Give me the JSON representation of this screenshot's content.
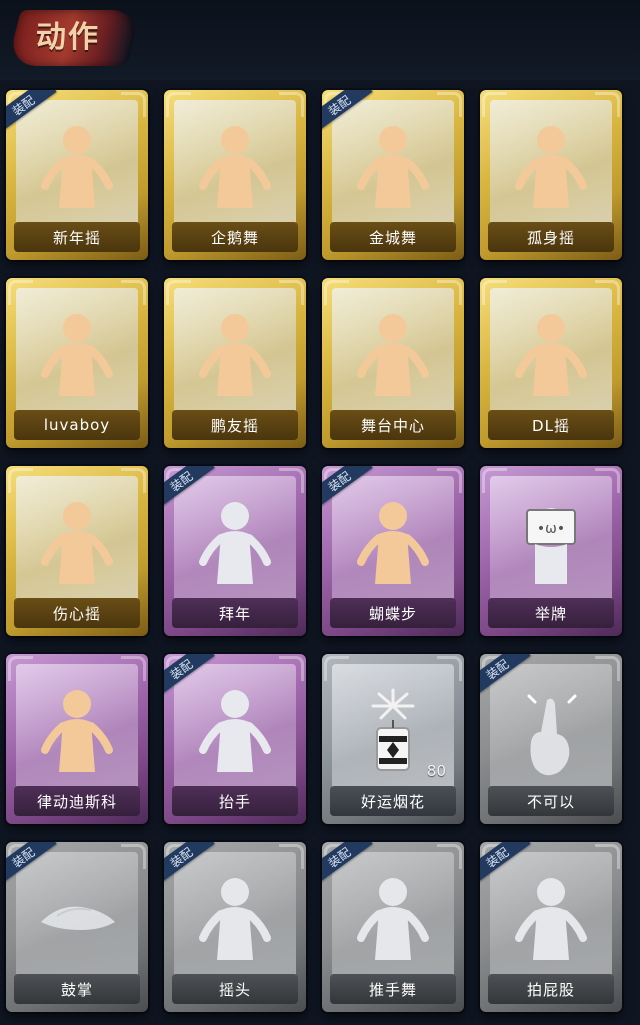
{
  "header": {
    "title": "动作"
  },
  "badge_label": "装配",
  "items": [
    {
      "label": "新年摇",
      "tier": "gold",
      "equipped": true,
      "icon": "dancer-clap-icon"
    },
    {
      "label": "企鹅舞",
      "tier": "gold",
      "equipped": false,
      "icon": "dancer-penguin-icon"
    },
    {
      "label": "金城舞",
      "tier": "gold",
      "equipped": true,
      "icon": "dancer-wave-icon"
    },
    {
      "label": "孤身摇",
      "tier": "gold",
      "equipped": false,
      "icon": "dancer-sway-icon"
    },
    {
      "label": "luvaboy",
      "tier": "gold",
      "equipped": false,
      "icon": "dancer-cross-icon"
    },
    {
      "label": "鹏友摇",
      "tier": "gold",
      "equipped": false,
      "icon": "dancer-shake-icon"
    },
    {
      "label": "舞台中心",
      "tier": "gold",
      "equipped": false,
      "icon": "dancer-center-icon"
    },
    {
      "label": "DL摇",
      "tier": "gold",
      "equipped": false,
      "icon": "dancer-point-icon"
    },
    {
      "label": "伤心摇",
      "tier": "gold",
      "equipped": false,
      "icon": "dancer-heart-icon"
    },
    {
      "label": "拜年",
      "tier": "purple",
      "equipped": true,
      "icon": "figure-bow-icon"
    },
    {
      "label": "蝴蝶步",
      "tier": "purple",
      "equipped": true,
      "icon": "figure-dab-icon"
    },
    {
      "label": "举牌",
      "tier": "purple",
      "equipped": false,
      "icon": "figure-sign-icon"
    },
    {
      "label": "律动迪斯科",
      "tier": "purple",
      "equipped": false,
      "icon": "figure-disco-icon"
    },
    {
      "label": "抬手",
      "tier": "purple",
      "equipped": true,
      "icon": "figure-raise-hand-icon"
    },
    {
      "label": "好运烟花",
      "tier": "silver",
      "equipped": false,
      "icon": "firework-icon",
      "count": "80"
    },
    {
      "label": "不可以",
      "tier": "grey",
      "equipped": true,
      "icon": "finger-wag-icon"
    },
    {
      "label": "鼓掌",
      "tier": "grey",
      "equipped": true,
      "icon": "clap-hands-icon"
    },
    {
      "label": "摇头",
      "tier": "grey",
      "equipped": true,
      "icon": "figure-headshake-icon"
    },
    {
      "label": "推手舞",
      "tier": "grey",
      "equipped": true,
      "icon": "figure-push-icon"
    },
    {
      "label": "拍屁股",
      "tier": "grey",
      "equipped": true,
      "icon": "figure-spank-icon"
    }
  ]
}
